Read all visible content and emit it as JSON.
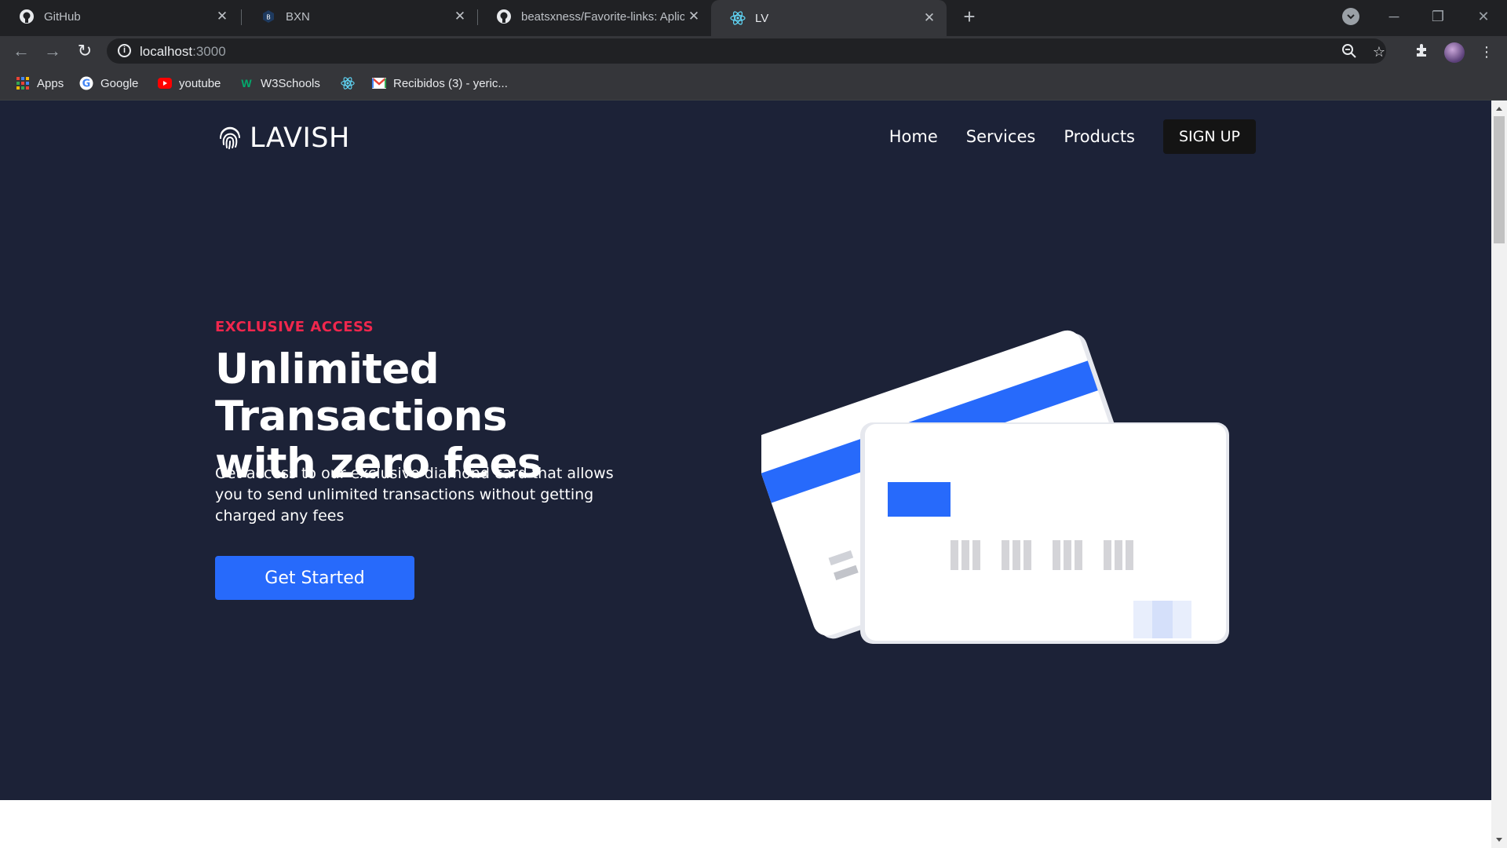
{
  "browser": {
    "tabs": [
      {
        "title": "GitHub",
        "icon": "github-icon",
        "active": false
      },
      {
        "title": "BXN",
        "icon": "bxn-icon",
        "active": false
      },
      {
        "title": "beatsxness/Favorite-links: Aplicac",
        "icon": "github-icon",
        "active": false
      },
      {
        "title": "LV",
        "icon": "react-icon",
        "active": true
      }
    ],
    "address": {
      "host": "localhost",
      "port": ":3000"
    },
    "bookmarks": [
      {
        "label": "Apps",
        "icon": "apps-grid-icon"
      },
      {
        "label": "Google",
        "icon": "google-icon"
      },
      {
        "label": "youtube",
        "icon": "youtube-icon"
      },
      {
        "label": "W3Schools",
        "icon": "w3schools-icon"
      },
      {
        "label": "",
        "icon": "react-icon"
      },
      {
        "label": "Recibidos (3) - yeric...",
        "icon": "gmail-icon"
      }
    ]
  },
  "site": {
    "brand": "LAVISH",
    "nav": {
      "home": "Home",
      "services": "Services",
      "products": "Products",
      "signup": "SIGN UP"
    },
    "hero": {
      "eyebrow": "EXCLUSIVE ACCESS",
      "headline_line1": "Unlimited Transactions",
      "headline_line2": "with zero fees",
      "description": "Get access to our exclusive diamond card that allows you to send unlimited transactions without getting charged any fees",
      "cta": "Get Started"
    }
  },
  "colors": {
    "hero_bg": "#1c2237",
    "accent_red": "#f0274d",
    "accent_blue": "#276afb",
    "signup_bg": "#141414"
  }
}
